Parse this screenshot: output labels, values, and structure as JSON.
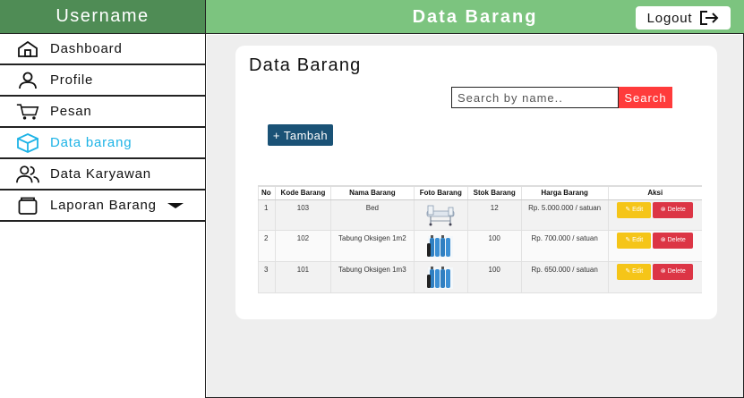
{
  "sidebar": {
    "username": "Username",
    "items": [
      {
        "label": "Dashboard",
        "icon": "home-icon"
      },
      {
        "label": "Profile",
        "icon": "user-icon"
      },
      {
        "label": "Pesan",
        "icon": "cart-icon"
      },
      {
        "label": "Data barang",
        "icon": "box-icon",
        "active": true
      },
      {
        "label": "Data Karyawan",
        "icon": "users-icon"
      },
      {
        "label": "Laporan Barang",
        "icon": "folder-icon",
        "has_dropdown": true
      }
    ]
  },
  "header": {
    "title": "Data Barang",
    "logout_label": "Logout"
  },
  "main": {
    "card_title": "Data Barang",
    "search": {
      "placeholder": "Search by name..",
      "button_label": "Search"
    },
    "add_button_label": "+ Tambah",
    "table": {
      "headers": [
        "No",
        "Kode Barang",
        "Nama Barang",
        "Foto Barang",
        "Stok Barang",
        "Harga Barang",
        "Aksi"
      ],
      "rows": [
        {
          "no": "1",
          "kode": "103",
          "nama": "Bed",
          "foto": "bed-image",
          "stok": "12",
          "harga": "Rp. 5.000.000 / satuan"
        },
        {
          "no": "2",
          "kode": "102",
          "nama": "Tabung Oksigen 1m2",
          "foto": "oxygen-tank-image",
          "stok": "100",
          "harga": "Rp. 700.000 / satuan"
        },
        {
          "no": "3",
          "kode": "101",
          "nama": "Tabung Oksigen 1m3",
          "foto": "oxygen-tank-image",
          "stok": "100",
          "harga": "Rp. 650.000 / satuan"
        }
      ],
      "edit_label": "Edit",
      "delete_label": "Delete"
    }
  },
  "colors": {
    "sidebar_header": "#4f8c55",
    "topbar": "#7cc47f",
    "active_item": "#1db3e6",
    "search_button": "#ff3b3b",
    "add_button": "#1a5276",
    "edit_button": "#f5c518",
    "delete_button": "#dc3545"
  }
}
